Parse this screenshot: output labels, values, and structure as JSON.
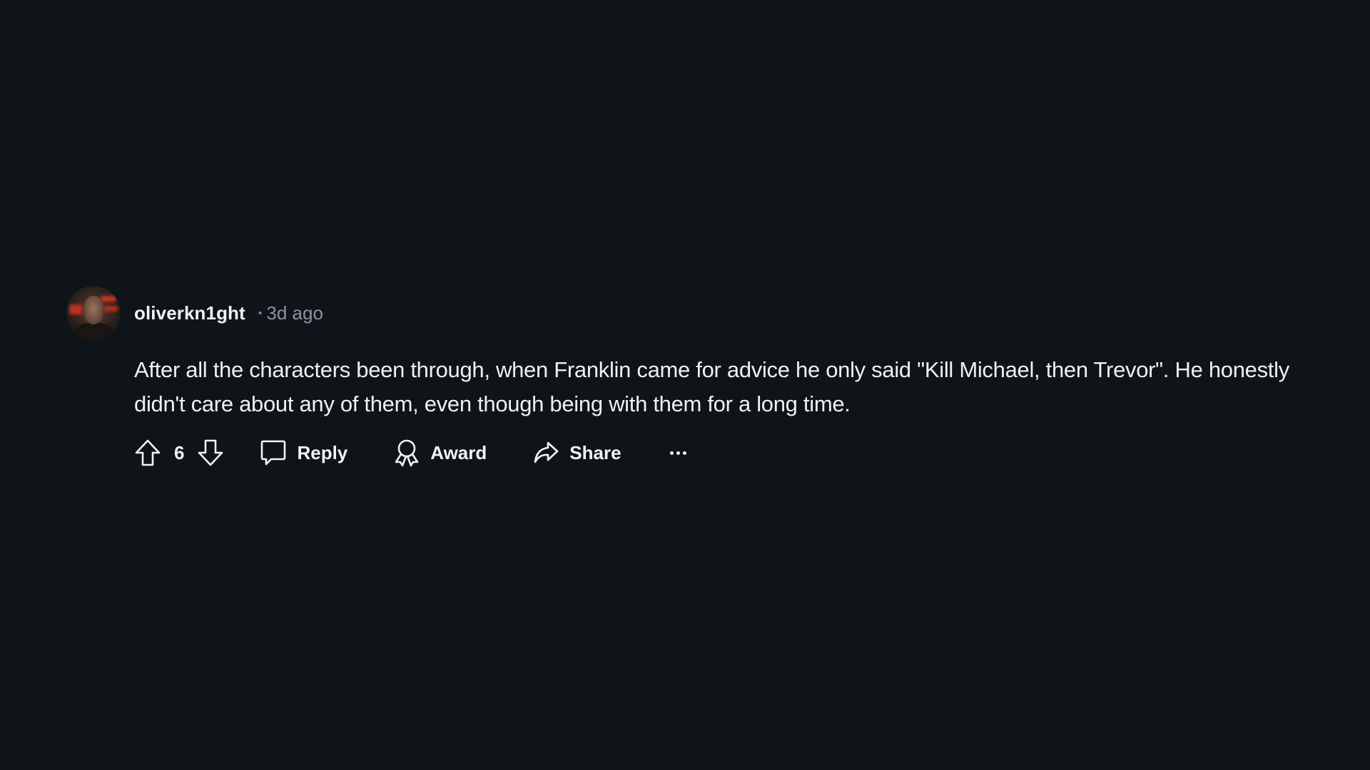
{
  "comment": {
    "author": "oliverkn1ght",
    "separator": "•",
    "timestamp": "3d ago",
    "body": "After all the characters been through, when Franklin came for advice he only said \"Kill Michael, then Trevor\". He honestly didn't care about any of them, even though being with them for a long time.",
    "avatar_icon": "user-avatar-photo"
  },
  "actions": {
    "upvote_icon": "arrow-up-outline-icon",
    "vote_count": "6",
    "downvote_icon": "arrow-down-outline-icon",
    "reply_label": "Reply",
    "reply_icon": "speech-bubble-icon",
    "award_label": "Award",
    "award_icon": "ribbon-award-icon",
    "share_label": "Share",
    "share_icon": "share-arrow-icon",
    "more_icon": "ellipsis-icon"
  },
  "colors": {
    "background": "#0e1418",
    "text_primary": "#f2f4f5",
    "text_secondary": "#8b959a"
  }
}
